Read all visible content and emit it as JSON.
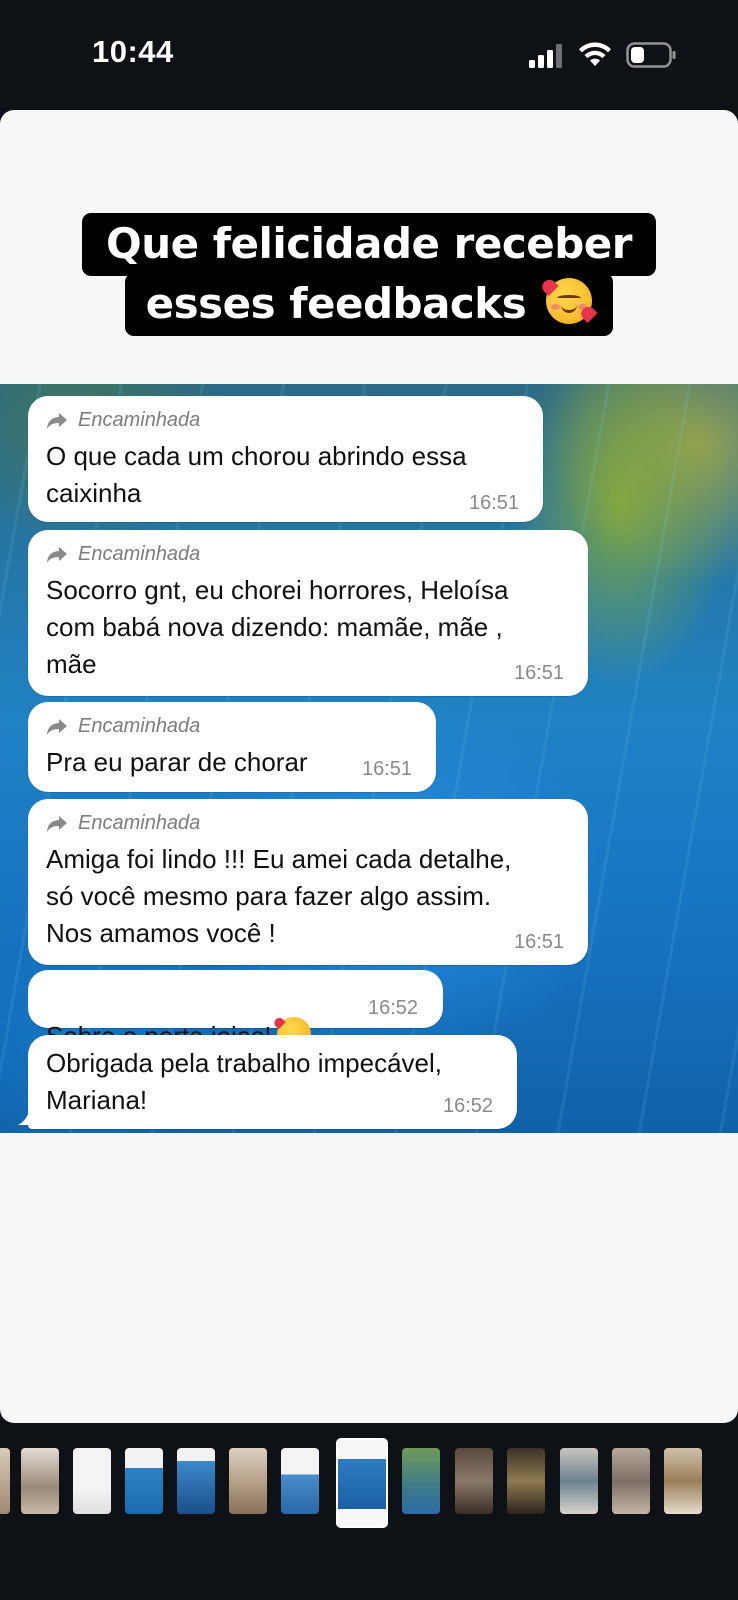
{
  "status_bar": {
    "time": "10:44"
  },
  "story": {
    "headline_line1": "Que felicidade receber",
    "headline_line2": "esses feedbacks",
    "headline_emoji": "smiling-face-with-hearts"
  },
  "chat": {
    "forwarded_label": "Encaminhada",
    "messages": [
      {
        "forwarded": true,
        "text": "O que cada um chorou abrindo essa\ncaixinha",
        "time": "16:51"
      },
      {
        "forwarded": true,
        "text": "Socorro gnt, eu chorei horrores, Heloísa\ncom babá nova dizendo: mamãe, mãe ,\nmãe",
        "time": "16:51"
      },
      {
        "forwarded": true,
        "text": "Pra eu parar de chorar",
        "time": "16:51"
      },
      {
        "forwarded": true,
        "text": "Amiga foi lindo !!! Eu amei cada detalhe,\nsó você mesmo para fazer algo assim.\nNos amamos você !",
        "time": "16:51"
      },
      {
        "forwarded": false,
        "text": "Sobre o porta joias!",
        "emoji": "smiling-face-with-hearts",
        "time": "16:52"
      },
      {
        "forwarded": false,
        "text": "Obrigada pela trabalho impecável,\nMariana!",
        "time": "16:52"
      }
    ]
  },
  "thumbnails": {
    "count": 14,
    "active_index": 7
  },
  "colors": {
    "background": "#0e1116",
    "card": "#f7f7f7",
    "headline_bg": "#000000",
    "bubble": "#ffffff",
    "timestamp": "#8a8a8a"
  }
}
